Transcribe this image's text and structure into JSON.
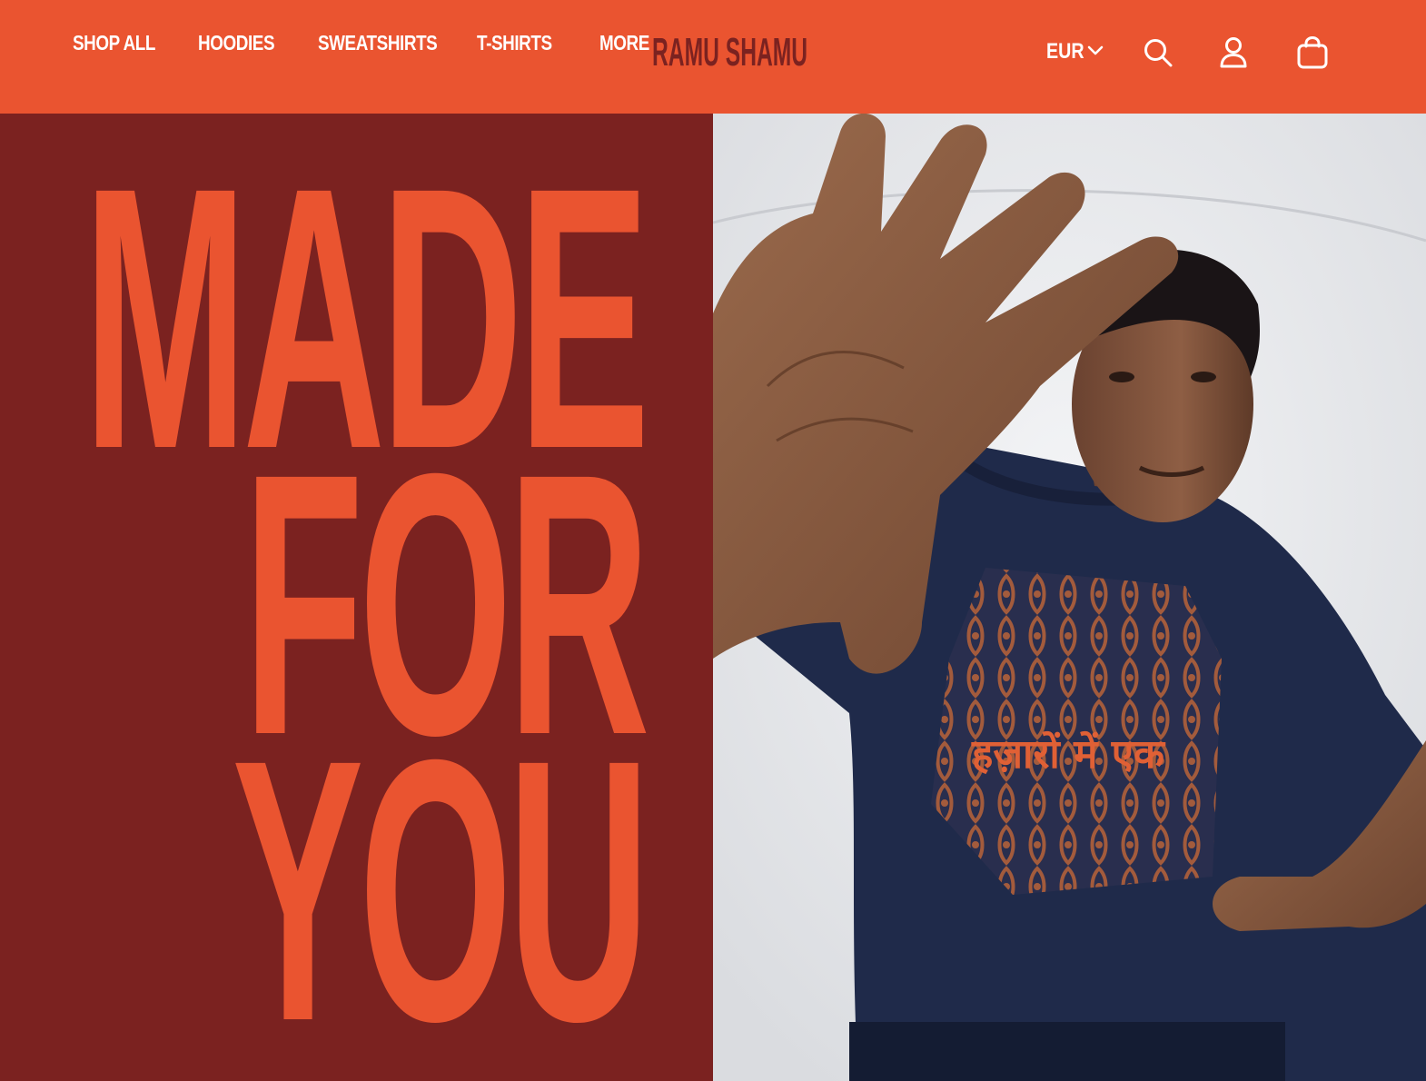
{
  "header": {
    "nav": [
      "SHOP ALL",
      "HOODIES",
      "SWEATSHIRTS",
      "T-SHIRTS",
      "MORE"
    ],
    "logo": "RAMU SHAMU",
    "currency": "EUR",
    "icons": {
      "currency_chevron": "chevron-down-icon",
      "search": "search-icon",
      "account": "user-icon",
      "cart": "shopping-bag-icon"
    }
  },
  "hero": {
    "headline": [
      "MADE",
      "FOR",
      "YOU"
    ],
    "shirt_print": "हज़ारों में एक"
  },
  "colors": {
    "accent": "#EA5430",
    "maroon": "#7B2220",
    "white": "#FFFFFF",
    "navy": "#1F2A4A"
  }
}
